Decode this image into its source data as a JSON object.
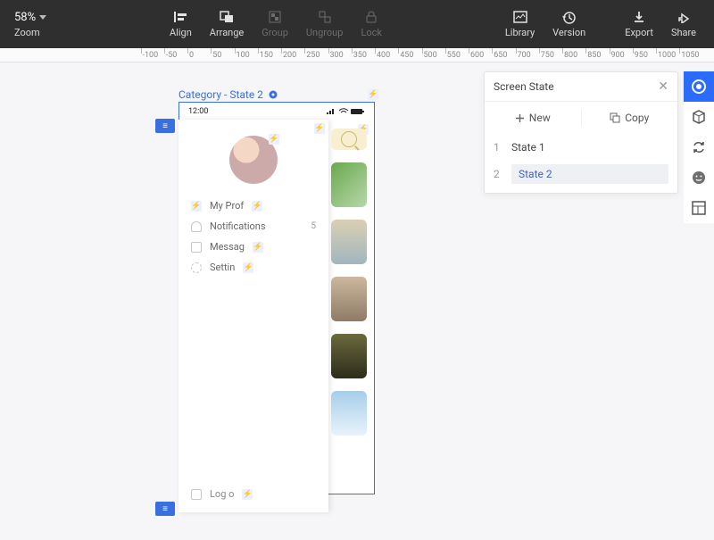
{
  "toolbar": {
    "zoom_value": "58%",
    "zoom_label": "Zoom",
    "align": "Align",
    "arrange": "Arrange",
    "group": "Group",
    "ungroup": "Ungroup",
    "lock": "Lock",
    "library": "Library",
    "version": "Version",
    "export": "Export",
    "share": "Share"
  },
  "ruler": {
    "ticks": [
      "-100",
      "-50",
      "0",
      "50",
      "100",
      "150",
      "200",
      "250",
      "300",
      "350",
      "400",
      "450",
      "500",
      "550",
      "600",
      "650",
      "700",
      "750",
      "800",
      "850",
      "900",
      "950",
      "1000",
      "1050"
    ]
  },
  "panel": {
    "title": "Screen State",
    "new": "New",
    "copy": "Copy",
    "states": [
      {
        "n": "1",
        "name": "State 1",
        "selected": false
      },
      {
        "n": "2",
        "name": "State 2",
        "selected": true
      }
    ]
  },
  "artboard": {
    "label": "Category - State 2",
    "status_time": "12:00",
    "drawer": {
      "items": [
        {
          "key": "profile",
          "label": "My Prof",
          "has_bolt": true
        },
        {
          "key": "notifications",
          "label": "Notifications",
          "badge": "5"
        },
        {
          "key": "messages",
          "label": "Messag",
          "has_bolt": true
        },
        {
          "key": "settings",
          "label": "Settin",
          "has_bolt": true
        }
      ],
      "logout": "Log o"
    }
  }
}
